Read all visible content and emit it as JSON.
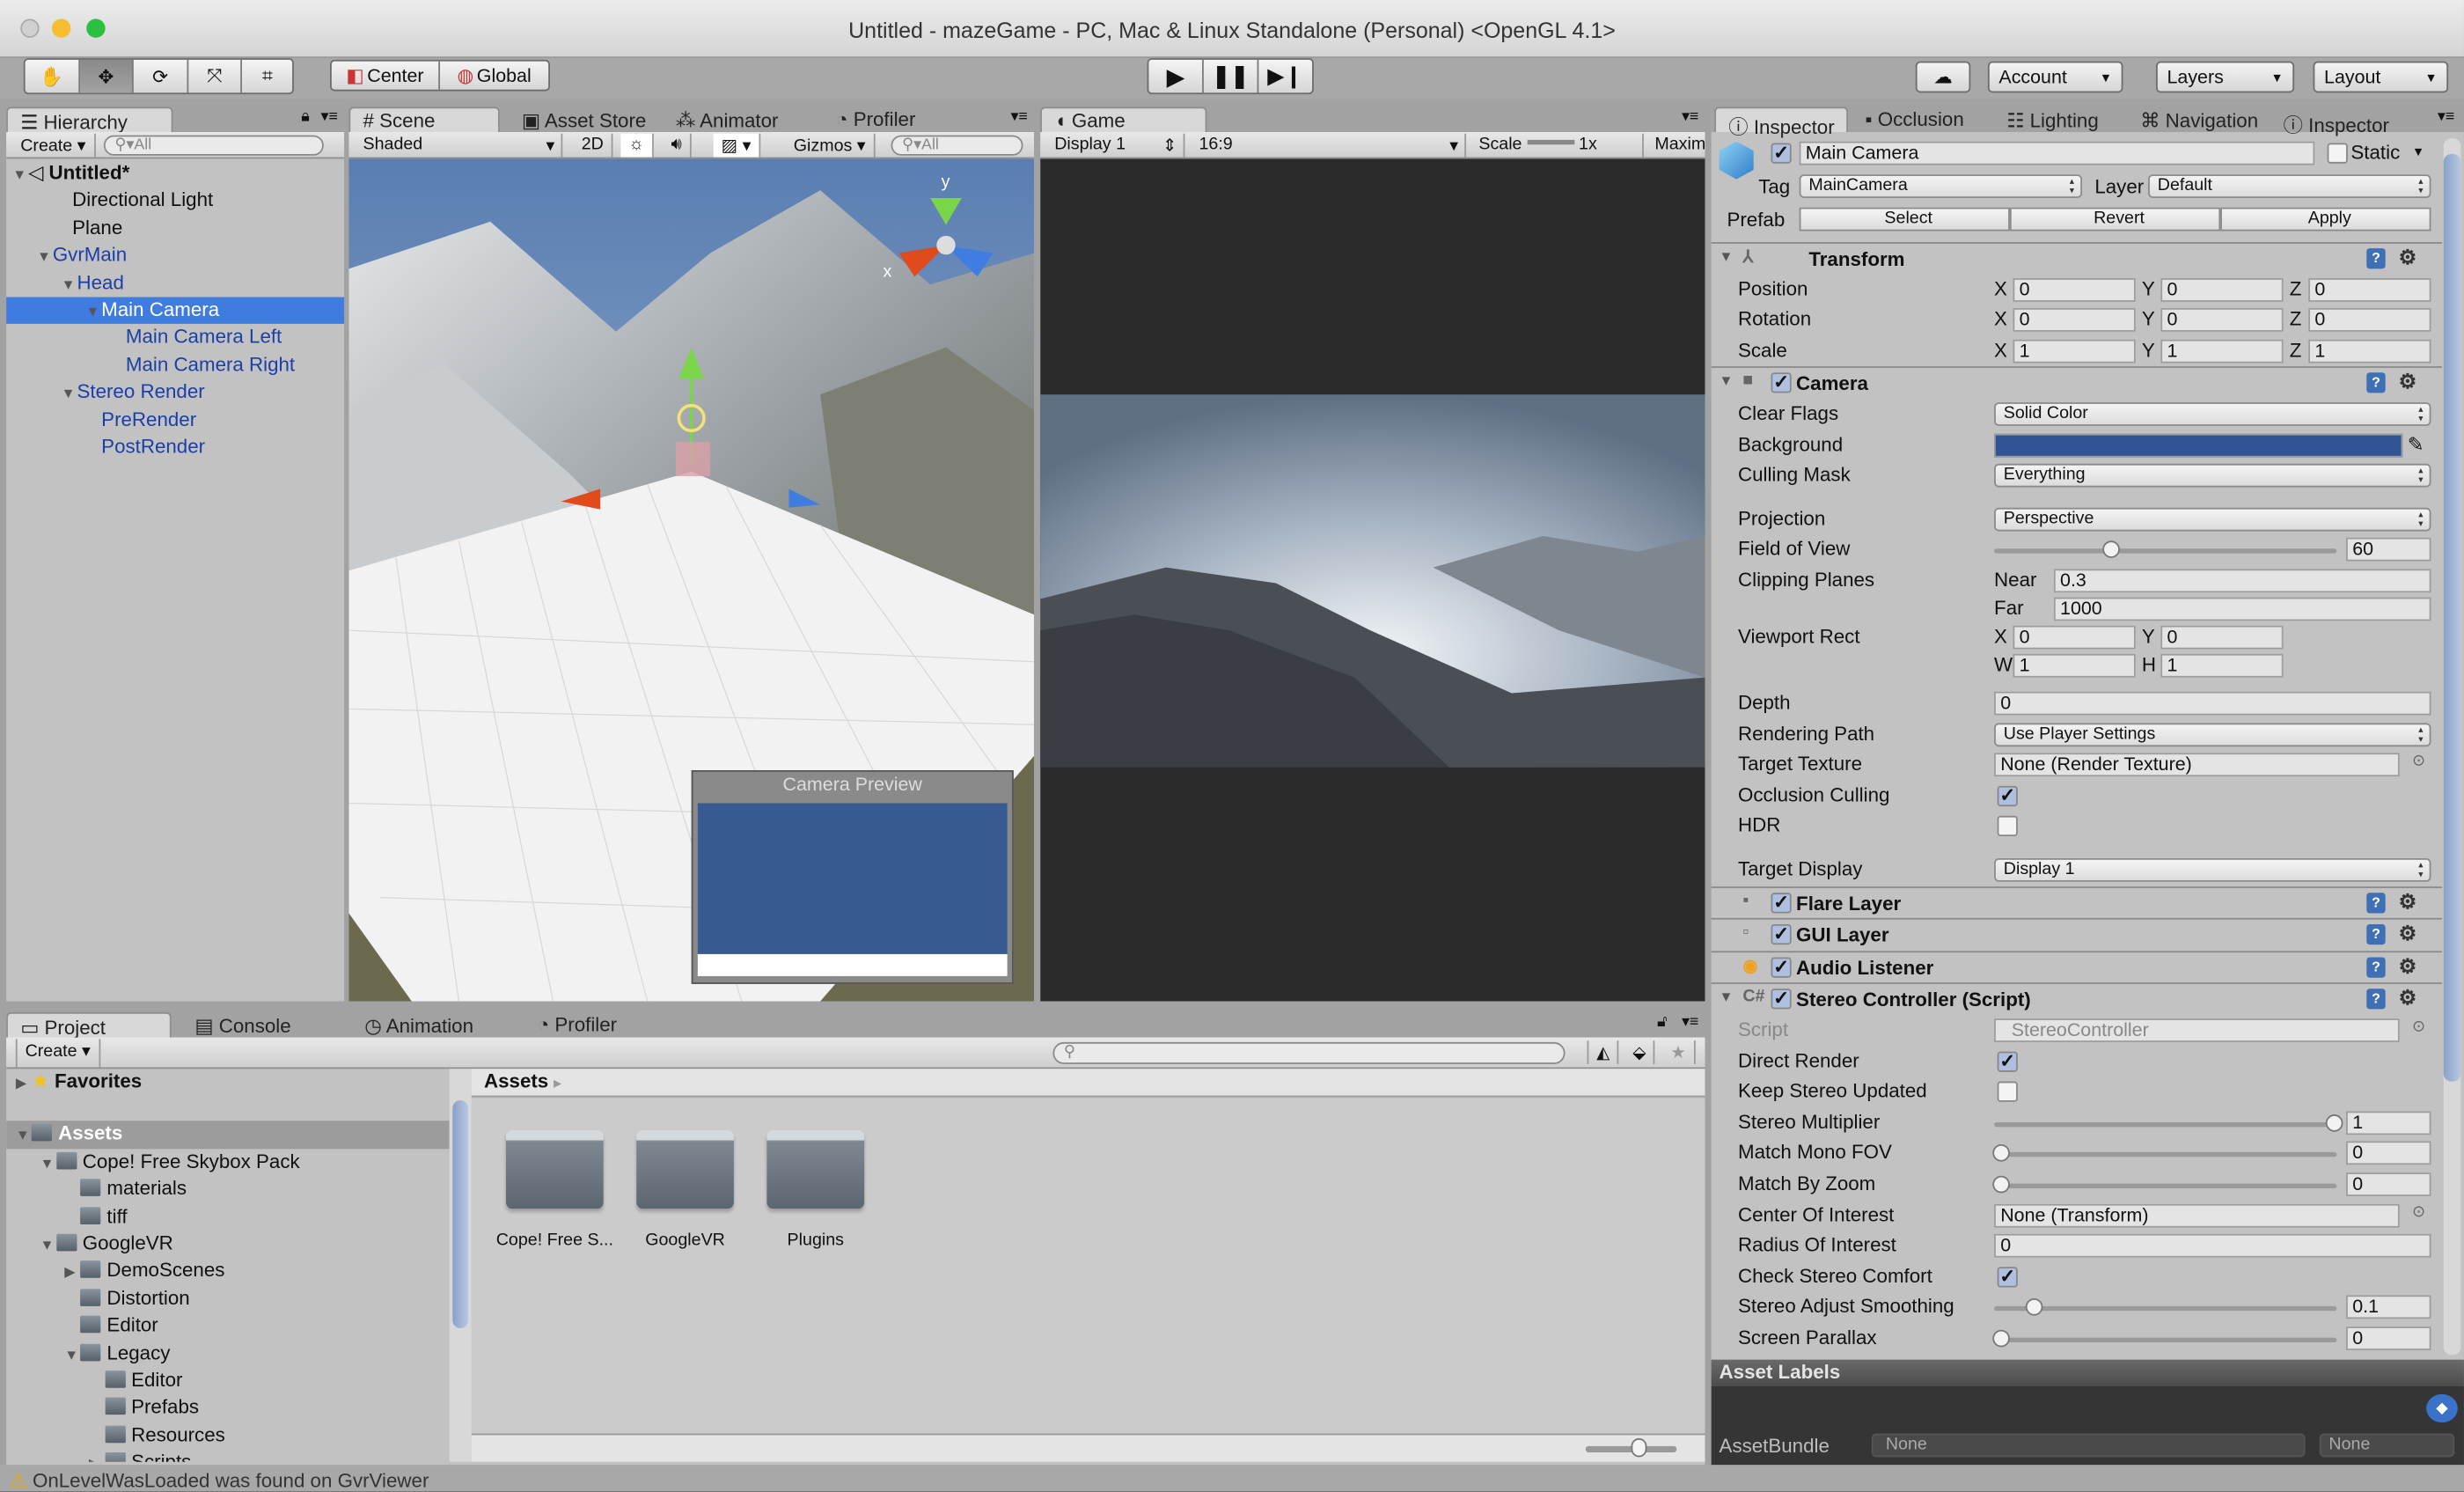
{
  "window": {
    "title": "Untitled - mazeGame - PC, Mac & Linux Standalone (Personal) <OpenGL 4.1>"
  },
  "toolbar": {
    "tools": [
      "hand-tool",
      "move-tool",
      "rotate-tool",
      "scale-tool",
      "rect-tool"
    ],
    "pivot": "Center",
    "space": "Global",
    "play_icons": [
      "play-icon",
      "pause-icon",
      "step-icon"
    ],
    "account": "Account",
    "layers": "Layers",
    "layout": "Layout"
  },
  "hierarchy": {
    "tab": "Hierarchy",
    "create": "Create",
    "search_placeholder": "All",
    "items": [
      {
        "label": "Untitled*",
        "level": 0,
        "expanded": true,
        "bold": true
      },
      {
        "label": "Directional Light",
        "level": 1
      },
      {
        "label": "Plane",
        "level": 1
      },
      {
        "label": "GvrMain",
        "level": 1,
        "expanded": true,
        "prefab": true
      },
      {
        "label": "Head",
        "level": 2,
        "expanded": true,
        "prefab": true
      },
      {
        "label": "Main Camera",
        "level": 3,
        "expanded": true,
        "prefab": true,
        "selected": true
      },
      {
        "label": "Main Camera Left",
        "level": 4,
        "prefab": true
      },
      {
        "label": "Main Camera Right",
        "level": 4,
        "prefab": true
      },
      {
        "label": "Stereo Render",
        "level": 2,
        "expanded": true,
        "prefab": true
      },
      {
        "label": "PreRender",
        "level": 3,
        "prefab": true
      },
      {
        "label": "PostRender",
        "level": 3,
        "prefab": true
      }
    ]
  },
  "scene": {
    "tabs": [
      "Scene",
      "Asset Store",
      "Animator",
      "Profiler"
    ],
    "shading": "Shaded",
    "mode_2d": "2D",
    "gizmos": "Gizmos",
    "search_placeholder": "All",
    "gizmo_axes": [
      "y",
      "x"
    ],
    "camera_preview_title": "Camera Preview"
  },
  "game": {
    "tab": "Game",
    "display": "Display 1",
    "aspect": "16:9",
    "scale_label": "Scale",
    "scale_value": "1x",
    "maximize": "Maxim"
  },
  "inspector": {
    "tabs": [
      "Inspector",
      "Occlusion",
      "Lighting",
      "Navigation",
      "Inspector"
    ],
    "object": {
      "name": "Main Camera",
      "active": true,
      "static_label": "Static",
      "tag_label": "Tag",
      "tag": "MainCamera",
      "layer_label": "Layer",
      "layer": "Default",
      "prefab_label": "Prefab",
      "prefab_buttons": [
        "Select",
        "Revert",
        "Apply"
      ]
    },
    "components": [
      {
        "name": "Transform",
        "icon": "transform-icon",
        "rows": [
          {
            "label": "Position",
            "type": "xyz",
            "values": [
              "0",
              "0",
              "0"
            ]
          },
          {
            "label": "Rotation",
            "type": "xyz",
            "values": [
              "0",
              "0",
              "0"
            ]
          },
          {
            "label": "Scale",
            "type": "xyz",
            "values": [
              "1",
              "1",
              "1"
            ]
          }
        ]
      },
      {
        "name": "Camera",
        "icon": "camera-icon",
        "enabled": true,
        "rows": [
          {
            "label": "Clear Flags",
            "type": "dropdown",
            "value": "Solid Color"
          },
          {
            "label": "Background",
            "type": "color",
            "value": "#2f5395"
          },
          {
            "label": "Culling Mask",
            "type": "dropdown",
            "value": "Everything"
          },
          {
            "label": "Projection",
            "type": "dropdown",
            "value": "Perspective"
          },
          {
            "label": "Field of View",
            "type": "slider",
            "value": "60",
            "fraction": 0.33
          },
          {
            "label": "Clipping Planes",
            "type": "pair",
            "sub": [
              [
                "Near",
                "0.3"
              ],
              [
                "Far",
                "1000"
              ]
            ]
          },
          {
            "label": "Viewport Rect",
            "type": "xywh",
            "sub": [
              [
                "X",
                "0",
                "Y",
                "0"
              ],
              [
                "W",
                "1",
                "H",
                "1"
              ]
            ]
          },
          {
            "label": "Depth",
            "type": "text",
            "value": "0"
          },
          {
            "label": "Rendering Path",
            "type": "dropdown",
            "value": "Use Player Settings"
          },
          {
            "label": "Target Texture",
            "type": "object",
            "value": "None (Render Texture)"
          },
          {
            "label": "Occlusion Culling",
            "type": "checkbox",
            "checked": true
          },
          {
            "label": "HDR",
            "type": "checkbox",
            "checked": false
          },
          {
            "label": "Target Display",
            "type": "dropdown",
            "value": "Display 1"
          }
        ]
      },
      {
        "name": "Flare Layer",
        "icon": "flare-layer-icon",
        "enabled": true,
        "rows": []
      },
      {
        "name": "GUI Layer",
        "icon": "gui-layer-icon",
        "enabled": true,
        "rows": []
      },
      {
        "name": "Audio Listener",
        "icon": "audio-listener-icon",
        "enabled": true,
        "rows": []
      },
      {
        "name": "Stereo Controller (Script)",
        "icon": "script-icon",
        "enabled": true,
        "expanded": true,
        "rows": [
          {
            "label": "Script",
            "type": "script",
            "value": "StereoController"
          },
          {
            "label": "Direct Render",
            "type": "checkbox",
            "checked": true
          },
          {
            "label": "Keep Stereo Updated",
            "type": "checkbox",
            "checked": false
          },
          {
            "label": "Stereo Multiplier",
            "type": "slider",
            "value": "1",
            "fraction": 1
          },
          {
            "label": "Match Mono FOV",
            "type": "slider",
            "value": "0",
            "fraction": 0
          },
          {
            "label": "Match By Zoom",
            "type": "slider",
            "value": "0",
            "fraction": 0
          },
          {
            "label": "Center Of Interest",
            "type": "object",
            "value": "None (Transform)"
          },
          {
            "label": "Radius Of Interest",
            "type": "text",
            "value": "0"
          },
          {
            "label": "Check Stereo Comfort",
            "type": "checkbox",
            "checked": true
          },
          {
            "label": "Stereo Adjust Smoothing",
            "type": "slider",
            "value": "0.1",
            "fraction": 0.1
          },
          {
            "label": "Screen Parallax",
            "type": "slider",
            "value": "0",
            "fraction": 0
          }
        ]
      }
    ],
    "asset_labels": "Asset Labels",
    "asset_bundle_label": "AssetBundle",
    "asset_bundle": "None",
    "asset_variant": "None"
  },
  "project": {
    "tabs": [
      "Project",
      "Console",
      "Animation",
      "Profiler"
    ],
    "create": "Create",
    "tree": [
      {
        "label": "Favorites",
        "level": 0,
        "collapsed": true,
        "star": true,
        "bold": true
      },
      {
        "label": "Assets",
        "level": 0,
        "expanded": true,
        "bold": true,
        "selected": true
      },
      {
        "label": "Cope! Free Skybox Pack",
        "level": 1,
        "expanded": true
      },
      {
        "label": "materials",
        "level": 2
      },
      {
        "label": "tiff",
        "level": 2
      },
      {
        "label": "GoogleVR",
        "level": 1,
        "expanded": true
      },
      {
        "label": "DemoScenes",
        "level": 2,
        "collapsed": true
      },
      {
        "label": "Distortion",
        "level": 2
      },
      {
        "label": "Editor",
        "level": 2
      },
      {
        "label": "Legacy",
        "level": 2,
        "expanded": true
      },
      {
        "label": "Editor",
        "level": 3
      },
      {
        "label": "Prefabs",
        "level": 3
      },
      {
        "label": "Resources",
        "level": 3
      },
      {
        "label": "Scripts",
        "level": 3,
        "collapsed": true
      }
    ],
    "breadcrumb": "Assets",
    "grid": [
      "Cope! Free S...",
      "GoogleVR",
      "Plugins"
    ]
  },
  "status": {
    "message": "OnLevelWasLoaded was found on GvrViewer"
  }
}
